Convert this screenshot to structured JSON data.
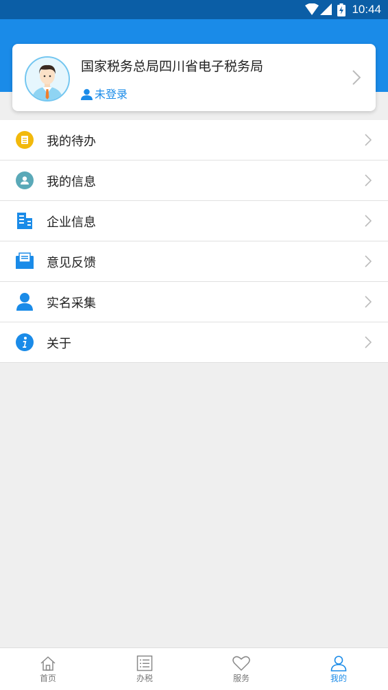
{
  "status_bar": {
    "time": "10:44"
  },
  "profile": {
    "title": "国家税务总局四川省电子税务局",
    "login_status": "未登录"
  },
  "menu": [
    {
      "label": "我的待办",
      "icon": "todo-icon"
    },
    {
      "label": "我的信息",
      "icon": "user-info-icon"
    },
    {
      "label": "企业信息",
      "icon": "building-icon"
    },
    {
      "label": "意见反馈",
      "icon": "feedback-mail-icon"
    },
    {
      "label": "实名采集",
      "icon": "person-icon"
    },
    {
      "label": "关于",
      "icon": "info-icon"
    }
  ],
  "tabs": [
    {
      "label": "首页",
      "icon": "home-icon",
      "active": false
    },
    {
      "label": "办税",
      "icon": "list-icon",
      "active": false
    },
    {
      "label": "服务",
      "icon": "heart-icon",
      "active": false
    },
    {
      "label": "我的",
      "icon": "user-icon",
      "active": true
    }
  ],
  "colors": {
    "status_bar": "#0b5ea6",
    "header": "#1a8be8",
    "accent": "#1a8be8",
    "background": "#efefef"
  }
}
